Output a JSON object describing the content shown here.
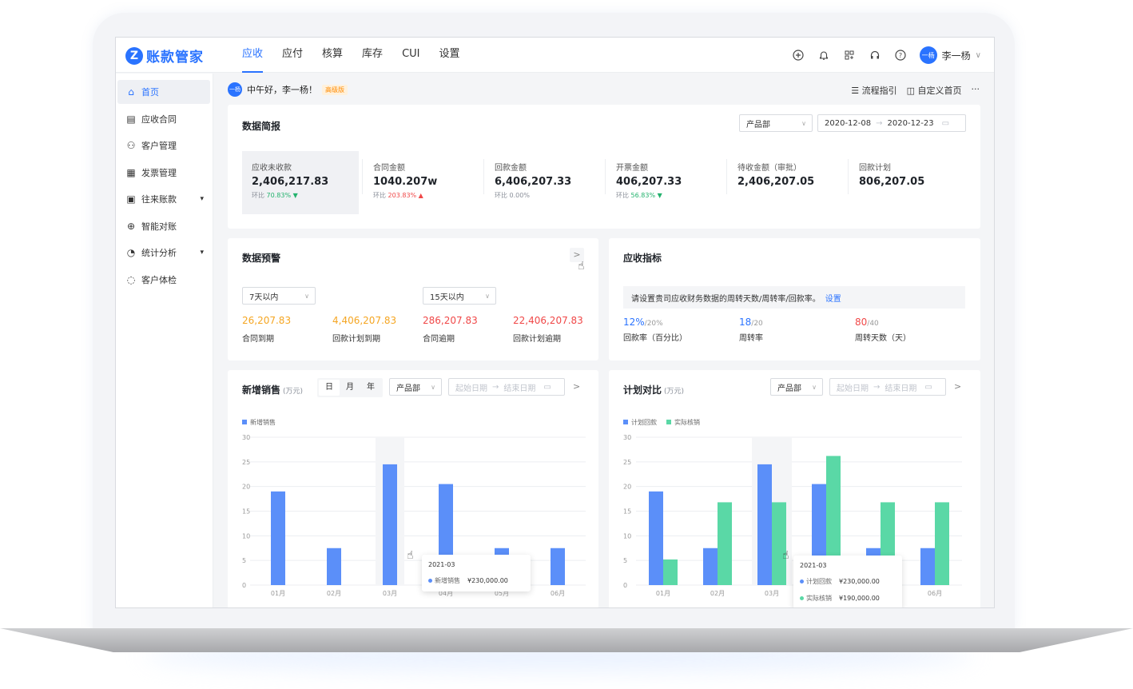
{
  "app": {
    "name": "账款管家",
    "logo_letter": "Z"
  },
  "nav": {
    "tabs": [
      "应收",
      "应付",
      "核算",
      "库存",
      "CUI",
      "设置"
    ],
    "active": 0
  },
  "top_icons": [
    "plus-circle-icon",
    "bell-icon",
    "apps-icon",
    "headset-icon",
    "help-icon"
  ],
  "user": {
    "avatar_text": "一杨",
    "name": "李一杨"
  },
  "sidebar": {
    "items": [
      {
        "label": "首页",
        "icon": "⌂",
        "name": "home"
      },
      {
        "label": "应收合同",
        "icon": "▤",
        "name": "receivable-contract"
      },
      {
        "label": "客户管理",
        "icon": "⚇",
        "name": "customer"
      },
      {
        "label": "发票管理",
        "icon": "▦",
        "name": "invoice"
      },
      {
        "label": "往来账款",
        "icon": "▣",
        "name": "accounts",
        "expand": true
      },
      {
        "label": "智能对账",
        "icon": "⊕",
        "name": "reconcile"
      },
      {
        "label": "统计分析",
        "icon": "◔",
        "name": "statistics",
        "expand": true
      },
      {
        "label": "客户体检",
        "icon": "◌",
        "name": "checkup"
      }
    ]
  },
  "greeting": {
    "avatar_text": "一杨",
    "text": "中午好，李一杨！",
    "badge": "高级版"
  },
  "quick_links": {
    "flow": "流程指引",
    "custom": "自定义首页",
    "more": "···"
  },
  "summary": {
    "title": "数据简报",
    "dept_select": "产品部",
    "date_start": "2020-12-08",
    "date_end": "2020-12-23",
    "metrics": [
      {
        "label": "应收未收款",
        "value": "2,406,217.83",
        "sub": "环比",
        "change": "70.83%",
        "dir": "down"
      },
      {
        "label": "合同金额",
        "value": "1040.207w",
        "sub": "环比",
        "change": "203.83%",
        "dir": "up"
      },
      {
        "label": "回款金额",
        "value": "6,406,207.33",
        "sub": "环比 0.00%",
        "change": "",
        "dir": ""
      },
      {
        "label": "开票金额",
        "value": "406,207.33",
        "sub": "环比",
        "change": "56.83%",
        "dir": "down"
      },
      {
        "label": "待收金额（审批）",
        "value": "2,406,207.05",
        "sub": "",
        "change": "",
        "dir": ""
      },
      {
        "label": "回款计划",
        "value": "806,207.05",
        "sub": "",
        "change": "",
        "dir": ""
      }
    ]
  },
  "warning": {
    "title": "数据预警",
    "select1": "7天以内",
    "select2": "15天以内",
    "items": [
      {
        "value": "26,207.83",
        "label": "合同到期",
        "color": "#f5a623"
      },
      {
        "value": "4,406,207.83",
        "label": "回款计划到期",
        "color": "#f5a623"
      },
      {
        "value": "286,207.83",
        "label": "合同逾期",
        "color": "#f04848"
      },
      {
        "value": "22,406,207.83",
        "label": "回款计划逾期",
        "color": "#f04848"
      }
    ]
  },
  "indicators": {
    "title": "应收指标",
    "notice": "请设置贵司应收财务数据的周转天数/周转率/回款率。",
    "notice_link": "设置",
    "items": [
      {
        "value": "12%",
        "target": "/20%",
        "label": "回款率（百分比）",
        "color": "#2a73ff"
      },
      {
        "value": "18",
        "target": "/20",
        "label": "周转率",
        "color": "#2a73ff"
      },
      {
        "value": "80",
        "target": "/40",
        "label": "周转天数（天）",
        "color": "#f04848"
      }
    ]
  },
  "sales": {
    "title": "新增销售",
    "unit": "(万元)",
    "segments": [
      "日",
      "月",
      "年"
    ],
    "dept_select": "产品部",
    "date_start_placeholder": "起始日期",
    "date_end_placeholder": "结束日期",
    "tooltip": {
      "title": "2021-03",
      "label": "新增销售",
      "value": "¥230,000.00"
    }
  },
  "plan": {
    "title": "计划对比",
    "unit": "(万元)",
    "dept_select": "产品部",
    "date_start_placeholder": "起始日期",
    "date_end_placeholder": "结束日期",
    "tooltip": {
      "title": "2021-03",
      "rows": [
        {
          "label": "计划回款",
          "value": "¥230,000.00"
        },
        {
          "label": "实际核销",
          "value": "¥190,000.00"
        }
      ]
    }
  },
  "chart_data": [
    {
      "type": "bar",
      "categories": [
        "01月",
        "02月",
        "03月",
        "04月",
        "05月",
        "06月"
      ],
      "series": [
        {
          "name": "新增销售",
          "values": [
            19,
            7.5,
            24.5,
            20.5,
            7.5,
            7.5
          ],
          "color": "#5b8ff9"
        }
      ],
      "ylim": [
        0,
        30
      ],
      "yticks": [
        0,
        5,
        10,
        15,
        20,
        25,
        30
      ],
      "highlight_index": 2
    },
    {
      "type": "bar",
      "categories": [
        "01月",
        "02月",
        "03月",
        "04月",
        "05月",
        "06月"
      ],
      "series": [
        {
          "name": "计划回款",
          "values": [
            19,
            7.5,
            24.5,
            20.5,
            7.5,
            7.5
          ],
          "color": "#5b8ff9"
        },
        {
          "name": "实际核销",
          "values": [
            5.2,
            16.8,
            16.8,
            26.2,
            16.8,
            16.8
          ],
          "color": "#5ad8a6"
        }
      ],
      "ylim": [
        0,
        30
      ],
      "yticks": [
        0,
        5,
        10,
        15,
        20,
        25,
        30
      ],
      "highlight_index": 2
    }
  ]
}
